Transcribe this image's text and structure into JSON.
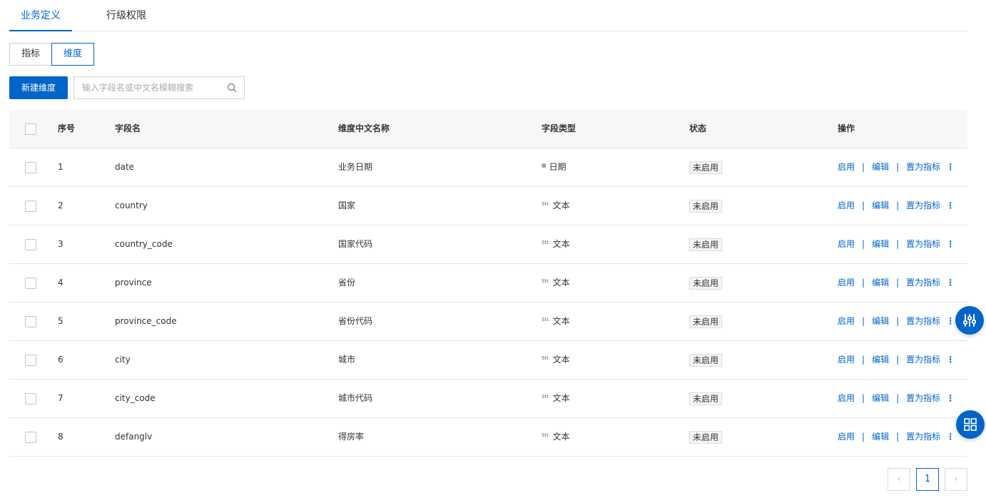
{
  "tabs": [
    {
      "label": "业务定义",
      "active": true
    },
    {
      "label": "行级权限",
      "active": false
    }
  ],
  "segments": [
    {
      "label": "指标",
      "active": false
    },
    {
      "label": "维度",
      "active": true
    }
  ],
  "toolbar": {
    "new_button": "新建维度",
    "search_placeholder": "输入字段名或中文名模糊搜索"
  },
  "table": {
    "headers": {
      "index": "序号",
      "field": "字段名",
      "cn_name": "维度中文名称",
      "type": "字段类型",
      "status": "状态",
      "ops": "操作"
    },
    "rows": [
      {
        "index": "1",
        "field": "date",
        "cn_name": "业务日期",
        "type_icon": "▦",
        "type": "日期",
        "status": "未启用"
      },
      {
        "index": "2",
        "field": "country",
        "cn_name": "国家",
        "type_icon": "Str.",
        "type": "文本",
        "status": "未启用"
      },
      {
        "index": "3",
        "field": "country_code",
        "cn_name": "国家代码",
        "type_icon": "Str.",
        "type": "文本",
        "status": "未启用"
      },
      {
        "index": "4",
        "field": "province",
        "cn_name": "省份",
        "type_icon": "Str.",
        "type": "文本",
        "status": "未启用"
      },
      {
        "index": "5",
        "field": "province_code",
        "cn_name": "省份代码",
        "type_icon": "Str.",
        "type": "文本",
        "status": "未启用"
      },
      {
        "index": "6",
        "field": "city",
        "cn_name": "城市",
        "type_icon": "Str.",
        "type": "文本",
        "status": "未启用"
      },
      {
        "index": "7",
        "field": "city_code",
        "cn_name": "城市代码",
        "type_icon": "Str.",
        "type": "文本",
        "status": "未启用"
      },
      {
        "index": "8",
        "field": "defanglv",
        "cn_name": "得房率",
        "type_icon": "Str.",
        "type": "文本",
        "status": "未启用"
      }
    ],
    "actions": {
      "enable": "启用",
      "edit": "编辑",
      "set_metric": "置为指标",
      "separator": "|",
      "more": "⋮"
    }
  },
  "pagination": {
    "prev": "‹",
    "current": "1",
    "next": "›"
  },
  "colors": {
    "accent": "#0064c8",
    "border": "#e5e5e5",
    "header_bg": "#f7f7f7"
  },
  "icons": {
    "search": "search-icon",
    "fab_top": "sliders-icon",
    "fab_bottom": "grid-icon"
  }
}
